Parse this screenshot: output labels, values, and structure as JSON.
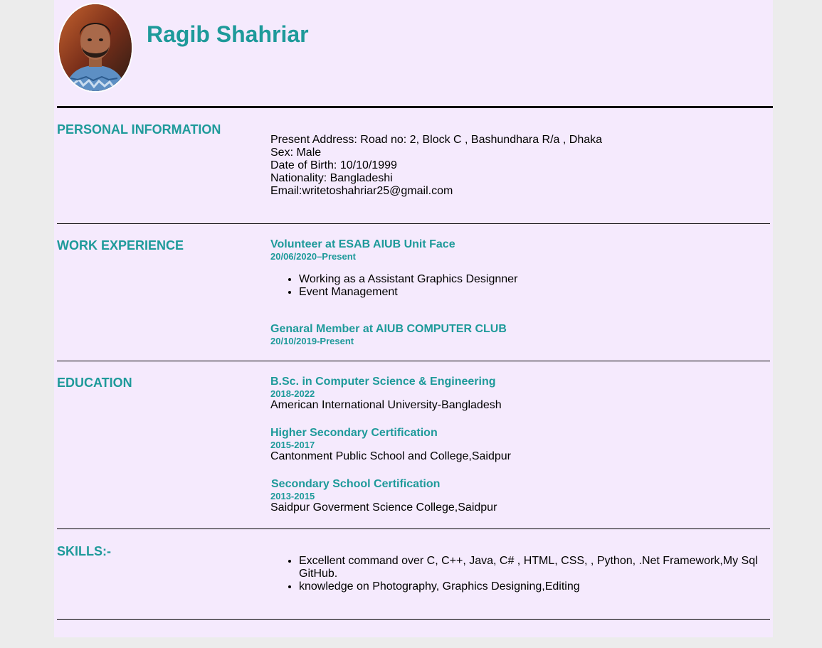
{
  "header": {
    "name": "Ragib Shahriar",
    "avatar_icon": "person-photo-icon"
  },
  "colors": {
    "accent": "#1e9a9a",
    "page_background": "#f5eafd",
    "outer_background": "#ececec"
  },
  "personal": {
    "heading": "PERSONAL INFORMATION",
    "lines": [
      "Present Address: Road no: 2, Block C , Bashundhara R/a , Dhaka",
      "Sex: Male",
      "Date of Birth: 10/10/1999",
      "Nationality: Bangladeshi",
      "Email:writetoshahriar25@gmail.com"
    ]
  },
  "work": {
    "heading": "WORK EXPERIENCE",
    "items": [
      {
        "title": "Volunteer at ESAB AIUB Unit Face",
        "date": "20/06/2020–Present",
        "bullets": [
          "Working as a Assistant Graphics Designner",
          "Event Management"
        ]
      },
      {
        "title": "Genaral Member at AIUB COMPUTER CLUB",
        "date": "20/10/2019-Present"
      }
    ]
  },
  "education": {
    "heading": "EDUCATION",
    "items": [
      {
        "title": "B.Sc. in Computer Science & Engineering",
        "date": "2018-2022",
        "institution": "American International University-Bangladesh"
      },
      {
        "title": "Higher Secondary Certification",
        "date": "2015-2017",
        "institution": "Cantonment Public School and College,Saidpur"
      },
      {
        "title": "Secondary School Certification",
        "date": "2013-2015",
        "institution": "Saidpur Goverment Science College,Saidpur"
      }
    ]
  },
  "skills": {
    "heading": "SKILLS:-",
    "bullets": [
      "Excellent command over C, C++, Java, C# , HTML, CSS, , Python, .Net Framework,My Sql GitHub.",
      "knowledge on Photography, Graphics Designing,Editing"
    ]
  }
}
